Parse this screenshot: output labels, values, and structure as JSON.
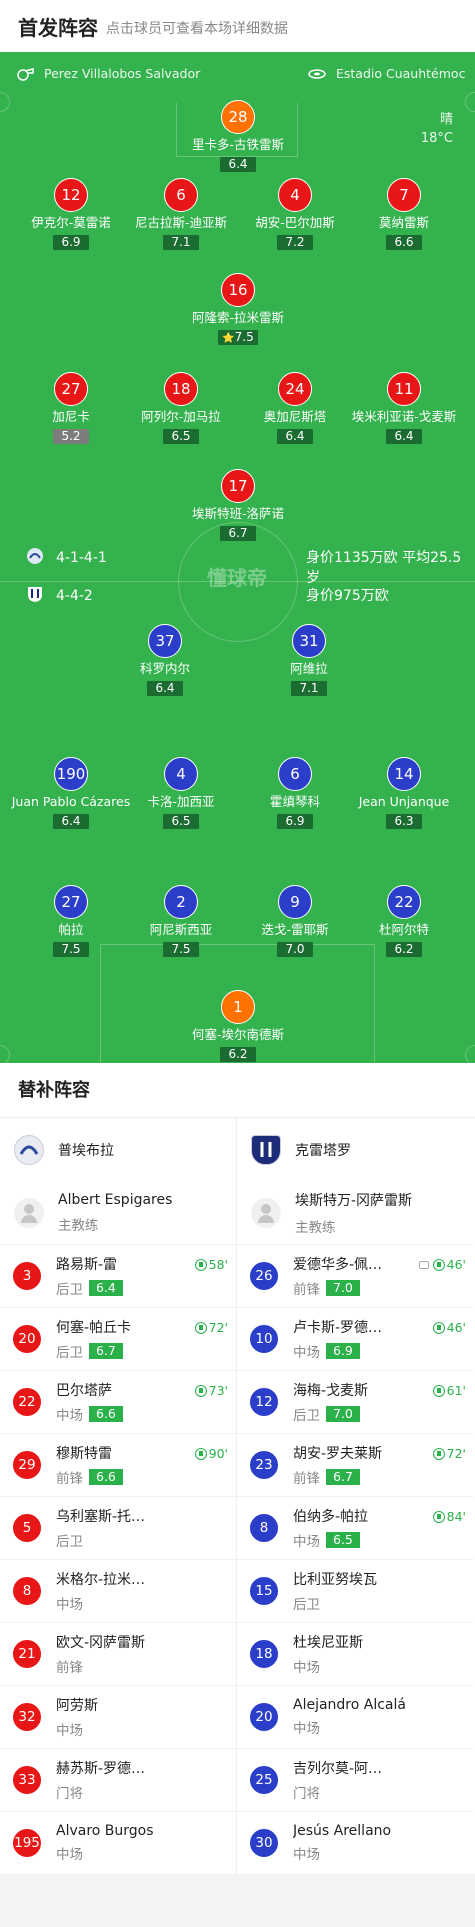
{
  "header": {
    "title": "首发阵容",
    "subtitle": "点击球员可查看本场详细数据"
  },
  "match_info": {
    "referee": "Perez Villalobos Salvador",
    "stadium": "Estadio Cuauhtémoc",
    "weather": "晴",
    "temperature": "18°C"
  },
  "home_formation": {
    "formation": "4-1-4-1",
    "value": "身价1135万欧 平均25.5岁"
  },
  "away_formation": {
    "formation": "4-4-2",
    "value": "身价975万欧"
  },
  "watermark": "懂球帝",
  "home_players": [
    {
      "number": "28",
      "name": "里卡多-古铁雷斯",
      "rating": "6.4",
      "gk": true
    },
    {
      "number": "12",
      "name": "伊克尔-莫雷诺",
      "rating": "6.9"
    },
    {
      "number": "6",
      "name": "尼古拉斯-迪亚斯",
      "rating": "7.1",
      "captain": "C",
      "yellow": true
    },
    {
      "number": "4",
      "name": "胡安-巴尔加斯",
      "rating": "7.2"
    },
    {
      "number": "7",
      "name": "莫纳雷斯",
      "rating": "6.6",
      "sub": "90'"
    },
    {
      "number": "16",
      "name": "阿隆索-拉米雷斯",
      "rating": "7.5",
      "star": true
    },
    {
      "number": "27",
      "name": "加尼卡",
      "rating": "5.2",
      "red": true,
      "goal": true,
      "gray": true
    },
    {
      "number": "18",
      "name": "阿列尔-加马拉",
      "rating": "6.5",
      "sub": "72'"
    },
    {
      "number": "24",
      "name": "奥加尼斯塔",
      "rating": "6.4",
      "sub": "73'"
    },
    {
      "number": "11",
      "name": "埃米利亚诺-戈麦斯",
      "rating": "6.4"
    },
    {
      "number": "17",
      "name": "埃斯特班-洛萨诺",
      "rating": "6.7",
      "sub": "58'"
    }
  ],
  "away_players": [
    {
      "number": "37",
      "name": "科罗内尔",
      "rating": "6.4"
    },
    {
      "number": "31",
      "name": "阿维拉",
      "rating": "7.1",
      "goal": true,
      "assist": true
    },
    {
      "number": "190",
      "name": "Juan Pablo Cázares",
      "rating": "6.4",
      "sub": "46'"
    },
    {
      "number": "4",
      "name": "卡洛-加西亚",
      "rating": "6.5",
      "sub": "46'"
    },
    {
      "number": "6",
      "name": "霍缜琴科",
      "rating": "6.9",
      "sub": "84'"
    },
    {
      "number": "14",
      "name": "Jean Unjanque",
      "rating": "6.3",
      "sub": "61'"
    },
    {
      "number": "27",
      "name": "帕拉",
      "rating": "7.5",
      "goal": true
    },
    {
      "number": "2",
      "name": "阿尼斯西亚",
      "rating": "7.5"
    },
    {
      "number": "9",
      "name": "迭戈-雷耶斯",
      "rating": "7.0",
      "captain": "C"
    },
    {
      "number": "22",
      "name": "杜阿尔特",
      "rating": "6.2",
      "sub": "72'"
    },
    {
      "number": "1",
      "name": "何塞-埃尔南德斯",
      "rating": "6.2",
      "gk": true
    }
  ],
  "bench": {
    "title": "替补阵容",
    "home": {
      "team": "普埃布拉",
      "coach": "Albert Espigares",
      "coach_role": "主教练",
      "players": [
        {
          "number": "3",
          "name": "路易斯-雷",
          "pos": "后卫",
          "rating": "6.4",
          "sub": "58'"
        },
        {
          "number": "20",
          "name": "何塞-帕丘卡",
          "pos": "后卫",
          "rating": "6.7",
          "sub": "72'"
        },
        {
          "number": "22",
          "name": "巴尔塔萨",
          "pos": "中场",
          "rating": "6.6",
          "sub": "73'"
        },
        {
          "number": "29",
          "name": "穆斯特雷",
          "pos": "前锋",
          "rating": "6.6",
          "sub": "90'"
        },
        {
          "number": "5",
          "name": "乌利塞斯-托…",
          "pos": "后卫"
        },
        {
          "number": "8",
          "name": "米格尔-拉米…",
          "pos": "中场"
        },
        {
          "number": "21",
          "name": "欧文-冈萨雷斯",
          "pos": "前锋"
        },
        {
          "number": "32",
          "name": "阿劳斯",
          "pos": "中场"
        },
        {
          "number": "33",
          "name": "赫苏斯-罗德…",
          "pos": "门将"
        },
        {
          "number": "195",
          "name": "Alvaro Burgos",
          "pos": "中场"
        }
      ]
    },
    "away": {
      "team": "克雷塔罗",
      "coach": "埃斯特万-冈萨雷斯",
      "coach_role": "主教练",
      "players": [
        {
          "number": "26",
          "name": "爱德华多-佩…",
          "pos": "前锋",
          "rating": "7.0",
          "sub": "46'",
          "extra": true
        },
        {
          "number": "10",
          "name": "卢卡斯-罗德…",
          "pos": "中场",
          "rating": "6.9",
          "sub": "46'"
        },
        {
          "number": "12",
          "name": "海梅-戈麦斯",
          "pos": "后卫",
          "rating": "7.0",
          "sub": "61'"
        },
        {
          "number": "23",
          "name": "胡安-罗夫莱斯",
          "pos": "前锋",
          "rating": "6.7",
          "sub": "72'"
        },
        {
          "number": "8",
          "name": "伯纳多-帕拉",
          "pos": "中场",
          "rating": "6.5",
          "sub": "84'"
        },
        {
          "number": "15",
          "name": "比利亚努埃瓦",
          "pos": "后卫"
        },
        {
          "number": "18",
          "name": "杜埃尼亚斯",
          "pos": "中场"
        },
        {
          "number": "20",
          "name": "Alejandro Alcalá",
          "pos": "中场"
        },
        {
          "number": "25",
          "name": "吉列尔莫-阿…",
          "pos": "门将"
        },
        {
          "number": "30",
          "name": "Jesús Arellano",
          "pos": "中场"
        }
      ]
    }
  }
}
